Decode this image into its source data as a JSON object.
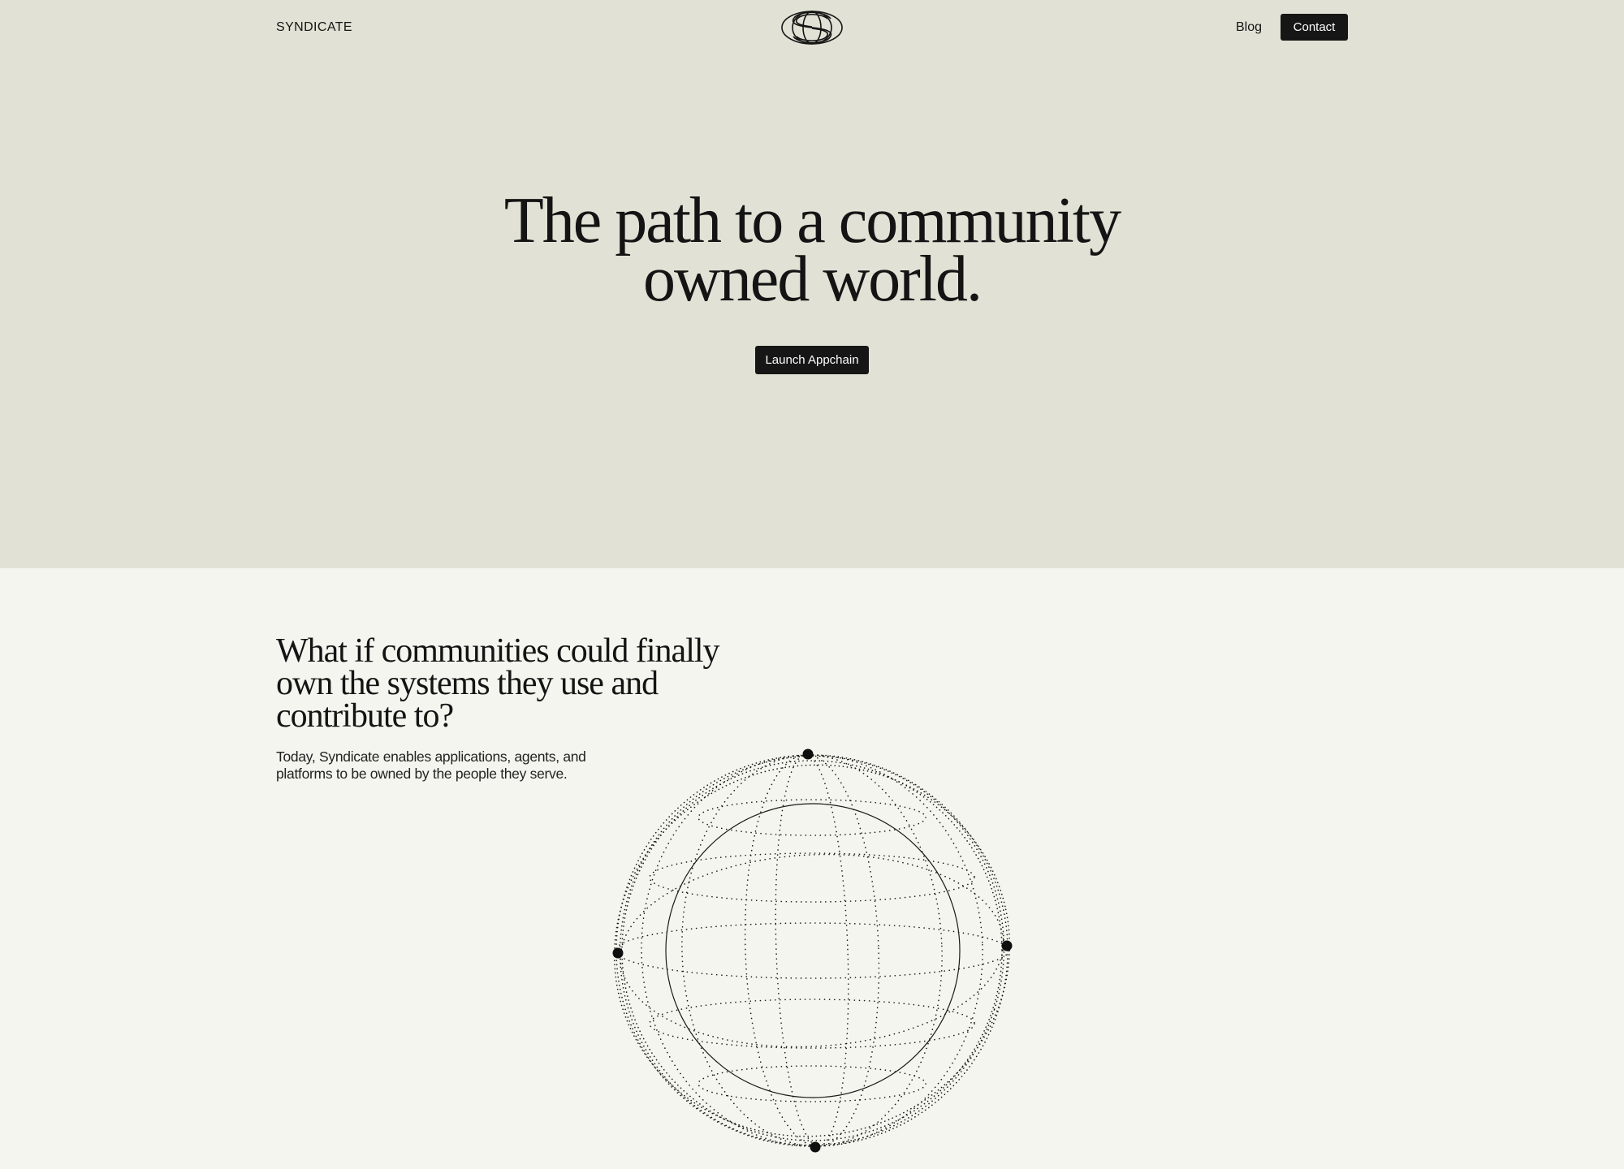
{
  "header": {
    "brand": "SYNDICATE",
    "logo_icon": "syndicate-s-logo-icon",
    "nav": {
      "blog_label": "Blog",
      "contact_label": "Contact"
    }
  },
  "hero": {
    "title_line1": "The path to a community",
    "title_line2": "owned world.",
    "cta_label": "Launch Appchain"
  },
  "section": {
    "title_line1": "What if communities could finally",
    "title_line2": "own the systems they use and",
    "title_line3": "contribute to?",
    "body_line1": "Today, Syndicate enables applications, agents, and",
    "body_line2": "platforms to be owned by the people they serve.",
    "illustration_icon": "dotted-wireframe-globe-icon"
  },
  "colors": {
    "hero_background": "#e1e2d5",
    "page_background": "#f5f5ef",
    "button_background": "#161616",
    "text": "#141414"
  }
}
